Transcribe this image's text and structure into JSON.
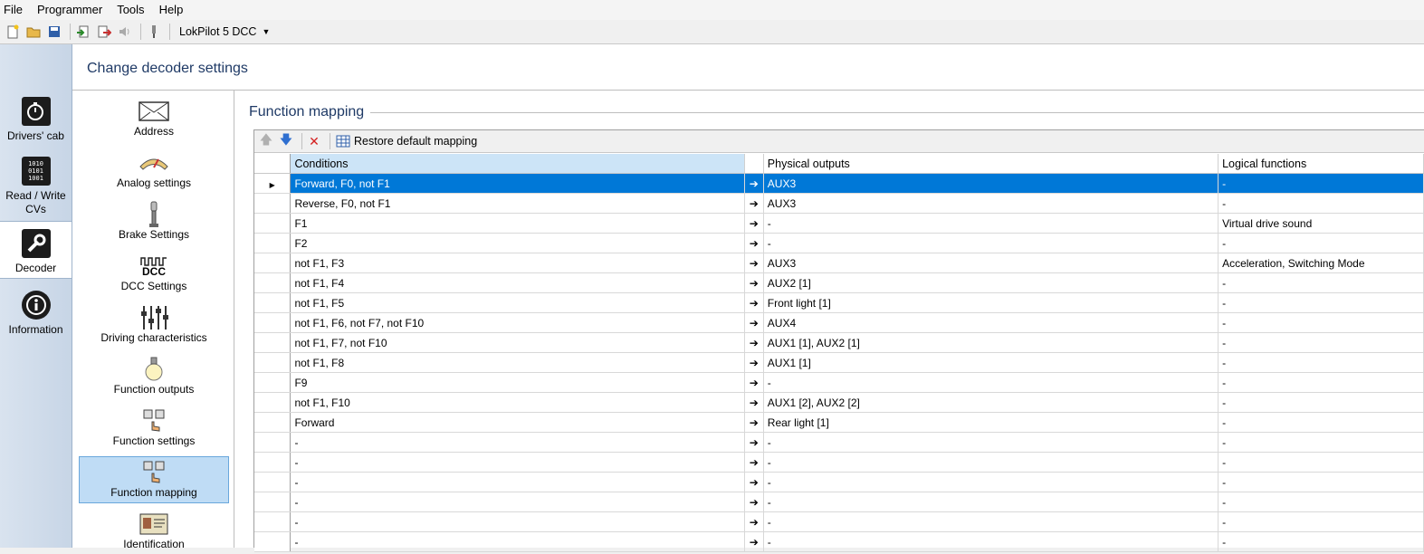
{
  "menu": [
    "File",
    "Programmer",
    "Tools",
    "Help"
  ],
  "toolbar": {
    "decoder": "LokPilot 5 DCC"
  },
  "leftnav": [
    {
      "label": "Drivers' cab",
      "icon": "stopwatch-icon"
    },
    {
      "label": "Read / Write CVs",
      "icon": "binary-icon"
    },
    {
      "label": "Decoder",
      "icon": "wrench-icon"
    },
    {
      "label": "Information",
      "icon": "info-icon"
    }
  ],
  "header": {
    "title": "Change decoder settings"
  },
  "categories": [
    {
      "label": "Address",
      "icon": "envelope-icon"
    },
    {
      "label": "Analog settings",
      "icon": "gauge-icon"
    },
    {
      "label": "Brake Settings",
      "icon": "brake-lever-icon"
    },
    {
      "label": "DCC Settings",
      "icon": "dcc-icon",
      "icon_text": "DCC"
    },
    {
      "label": "Driving characteristics",
      "icon": "sliders-icon"
    },
    {
      "label": "Function outputs",
      "icon": "lightbulb-icon"
    },
    {
      "label": "Function settings",
      "icon": "function-keys-icon"
    },
    {
      "label": "Function mapping",
      "icon": "function-keys-icon"
    },
    {
      "label": "Identification",
      "icon": "id-card-icon"
    }
  ],
  "section": {
    "title": "Function mapping"
  },
  "grid_toolbar": {
    "restore_label": "Restore default mapping"
  },
  "table": {
    "headers": [
      "Conditions",
      "Physical outputs",
      "Logical functions"
    ],
    "rows": [
      [
        "Forward, F0, not F1",
        "AUX3",
        "-"
      ],
      [
        "Reverse, F0, not F1",
        "AUX3",
        "-"
      ],
      [
        "F1",
        "-",
        "Virtual drive sound"
      ],
      [
        "F2",
        "-",
        "-"
      ],
      [
        "not F1, F3",
        "AUX3",
        "Acceleration, Switching Mode"
      ],
      [
        "not F1, F4",
        "AUX2 [1]",
        "-"
      ],
      [
        "not F1, F5",
        "Front light [1]",
        "-"
      ],
      [
        "not F1, F6, not F7, not F10",
        "AUX4",
        "-"
      ],
      [
        "not F1, F7, not F10",
        "AUX1 [1], AUX2 [1]",
        "-"
      ],
      [
        "not F1, F8",
        "AUX1 [1]",
        "-"
      ],
      [
        "F9",
        "-",
        "-"
      ],
      [
        "not F1, F10",
        "AUX1 [2], AUX2 [2]",
        "-"
      ],
      [
        "Forward",
        "Rear light [1]",
        "-"
      ],
      [
        "-",
        "-",
        "-"
      ],
      [
        "-",
        "-",
        "-"
      ],
      [
        "-",
        "-",
        "-"
      ],
      [
        "-",
        "-",
        "-"
      ],
      [
        "-",
        "-",
        "-"
      ],
      [
        "-",
        "-",
        "-"
      ]
    ]
  }
}
